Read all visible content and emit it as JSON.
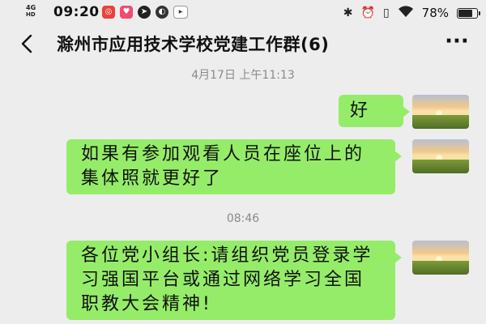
{
  "status_bar": {
    "network": "4G",
    "network_sub": "HD",
    "time": "09:20",
    "battery_text": "78%",
    "battery_level": 0.78,
    "app_icons": [
      "notification-app-red-icon",
      "notification-app-pink-icon",
      "telegram-icon",
      "compass-icon",
      "video-app-icon"
    ],
    "system_icons": [
      "bluetooth-icon",
      "alarm-icon",
      "vibrate-icon",
      "wifi-icon",
      "battery-icon"
    ]
  },
  "header": {
    "title": "滁州市应用技术学校党建工作群(6)",
    "back_icon": "chevron-left-icon",
    "more_label": "···"
  },
  "messages": [
    {
      "type": "timestamp",
      "text": "4月17日 上午11:13"
    },
    {
      "type": "outgoing",
      "text": "好",
      "avatar": "sunset-field-avatar"
    },
    {
      "type": "outgoing",
      "text": "如果有参加观看人员在座位上的集体照就更好了",
      "avatar": "sunset-field-avatar"
    },
    {
      "type": "timestamp",
      "text": "08:46"
    },
    {
      "type": "outgoing",
      "text": "各位党小组长:请组织党员登录学习强国平台或通过网络学习全国职教大会精神!",
      "avatar": "sunset-field-avatar"
    }
  ],
  "colors": {
    "background": "#ededed",
    "bubble": "#95ec69",
    "timestamp": "#8a8a8a"
  }
}
